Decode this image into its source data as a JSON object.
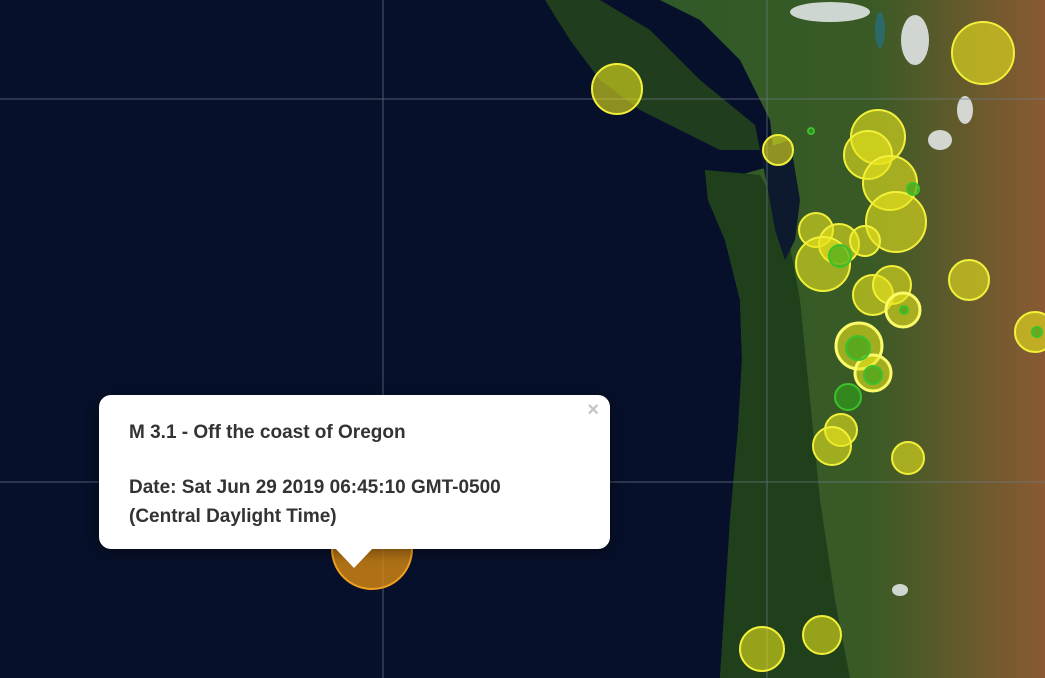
{
  "popup": {
    "title": "M 3.1 - Off the coast of Oregon",
    "date_line1": "Date: Sat Jun 29 2019 06:45:10 GMT-0500",
    "date_line2": "(Central Daylight Time)",
    "close_symbol": "×"
  },
  "colors": {
    "ocean": "#060c1c",
    "land_dark": "#22401f",
    "land_forest": "#2f5a28",
    "land_dry": "#8a5a32",
    "quake_yellow": "#e7e41c",
    "quake_green": "#2ea51c",
    "quake_orange": "#d98a10",
    "graticule": "#6d7a8a"
  }
}
